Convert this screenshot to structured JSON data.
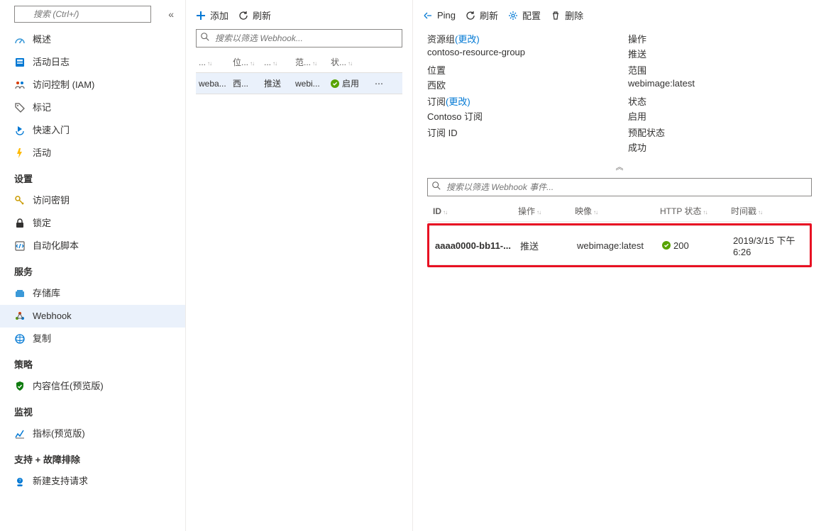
{
  "sidebar": {
    "search_placeholder": "搜索 (Ctrl+/)",
    "items_top": [
      {
        "icon": "overview",
        "label": "概述"
      },
      {
        "icon": "log",
        "label": "活动日志"
      },
      {
        "icon": "iam",
        "label": "访问控制 (IAM)"
      },
      {
        "icon": "tag",
        "label": "标记"
      },
      {
        "icon": "quickstart",
        "label": "快速入门"
      },
      {
        "icon": "events",
        "label": "活动"
      }
    ],
    "sections": [
      {
        "title": "设置",
        "items": [
          {
            "icon": "key",
            "label": "访问密钥"
          },
          {
            "icon": "lock",
            "label": "锁定"
          },
          {
            "icon": "script",
            "label": "自动化脚本"
          }
        ]
      },
      {
        "title": "服务",
        "items": [
          {
            "icon": "repo",
            "label": "存储库"
          },
          {
            "icon": "webhook",
            "label": "Webhook",
            "selected": true
          },
          {
            "icon": "replication",
            "label": "复制"
          }
        ]
      },
      {
        "title": "策略",
        "items": [
          {
            "icon": "shield",
            "label": "内容信任(预览版)"
          }
        ]
      },
      {
        "title": "监视",
        "items": [
          {
            "icon": "metrics",
            "label": "指标(预览版)"
          }
        ]
      },
      {
        "title": "支持 + 故障排除",
        "items": [
          {
            "icon": "support",
            "label": "新建支持请求"
          }
        ]
      }
    ]
  },
  "middle": {
    "toolbar": {
      "add": "添加",
      "refresh": "刷新"
    },
    "search_placeholder": "搜索以筛选 Webhook...",
    "columns": [
      "...",
      "位...",
      "...",
      "范...",
      "状..."
    ],
    "row": {
      "name": "weba...",
      "loc": "西...",
      "action": "推送",
      "scope": "webi...",
      "status": "启用"
    }
  },
  "right": {
    "toolbar": {
      "ping": "Ping",
      "refresh": "刷新",
      "config": "配置",
      "delete": "删除"
    },
    "details": [
      {
        "label": "资源组",
        "change": "(更改)",
        "value": "contoso-resource-group",
        "link": true
      },
      {
        "label": "操作",
        "value": "推送"
      },
      {
        "label": "位置",
        "value": "西欧"
      },
      {
        "label": "范围",
        "value": "webimage:latest"
      },
      {
        "label": "订阅",
        "change": "(更改)",
        "value": "Contoso 订阅",
        "link": true
      },
      {
        "label": "状态",
        "value": "启用"
      },
      {
        "label": "订阅 ID",
        "value": ""
      },
      {
        "label": "预配状态",
        "value": "成功"
      }
    ],
    "events_search_placeholder": "搜索以筛选 Webhook 事件...",
    "events": {
      "columns": [
        "ID",
        "操作",
        "映像",
        "HTTP 状态",
        "时间戳"
      ],
      "row": {
        "id": "aaaa0000-bb11-...",
        "action": "推送",
        "image": "webimage:latest",
        "status": "200",
        "time": "2019/3/15 下午 6:26"
      }
    }
  }
}
